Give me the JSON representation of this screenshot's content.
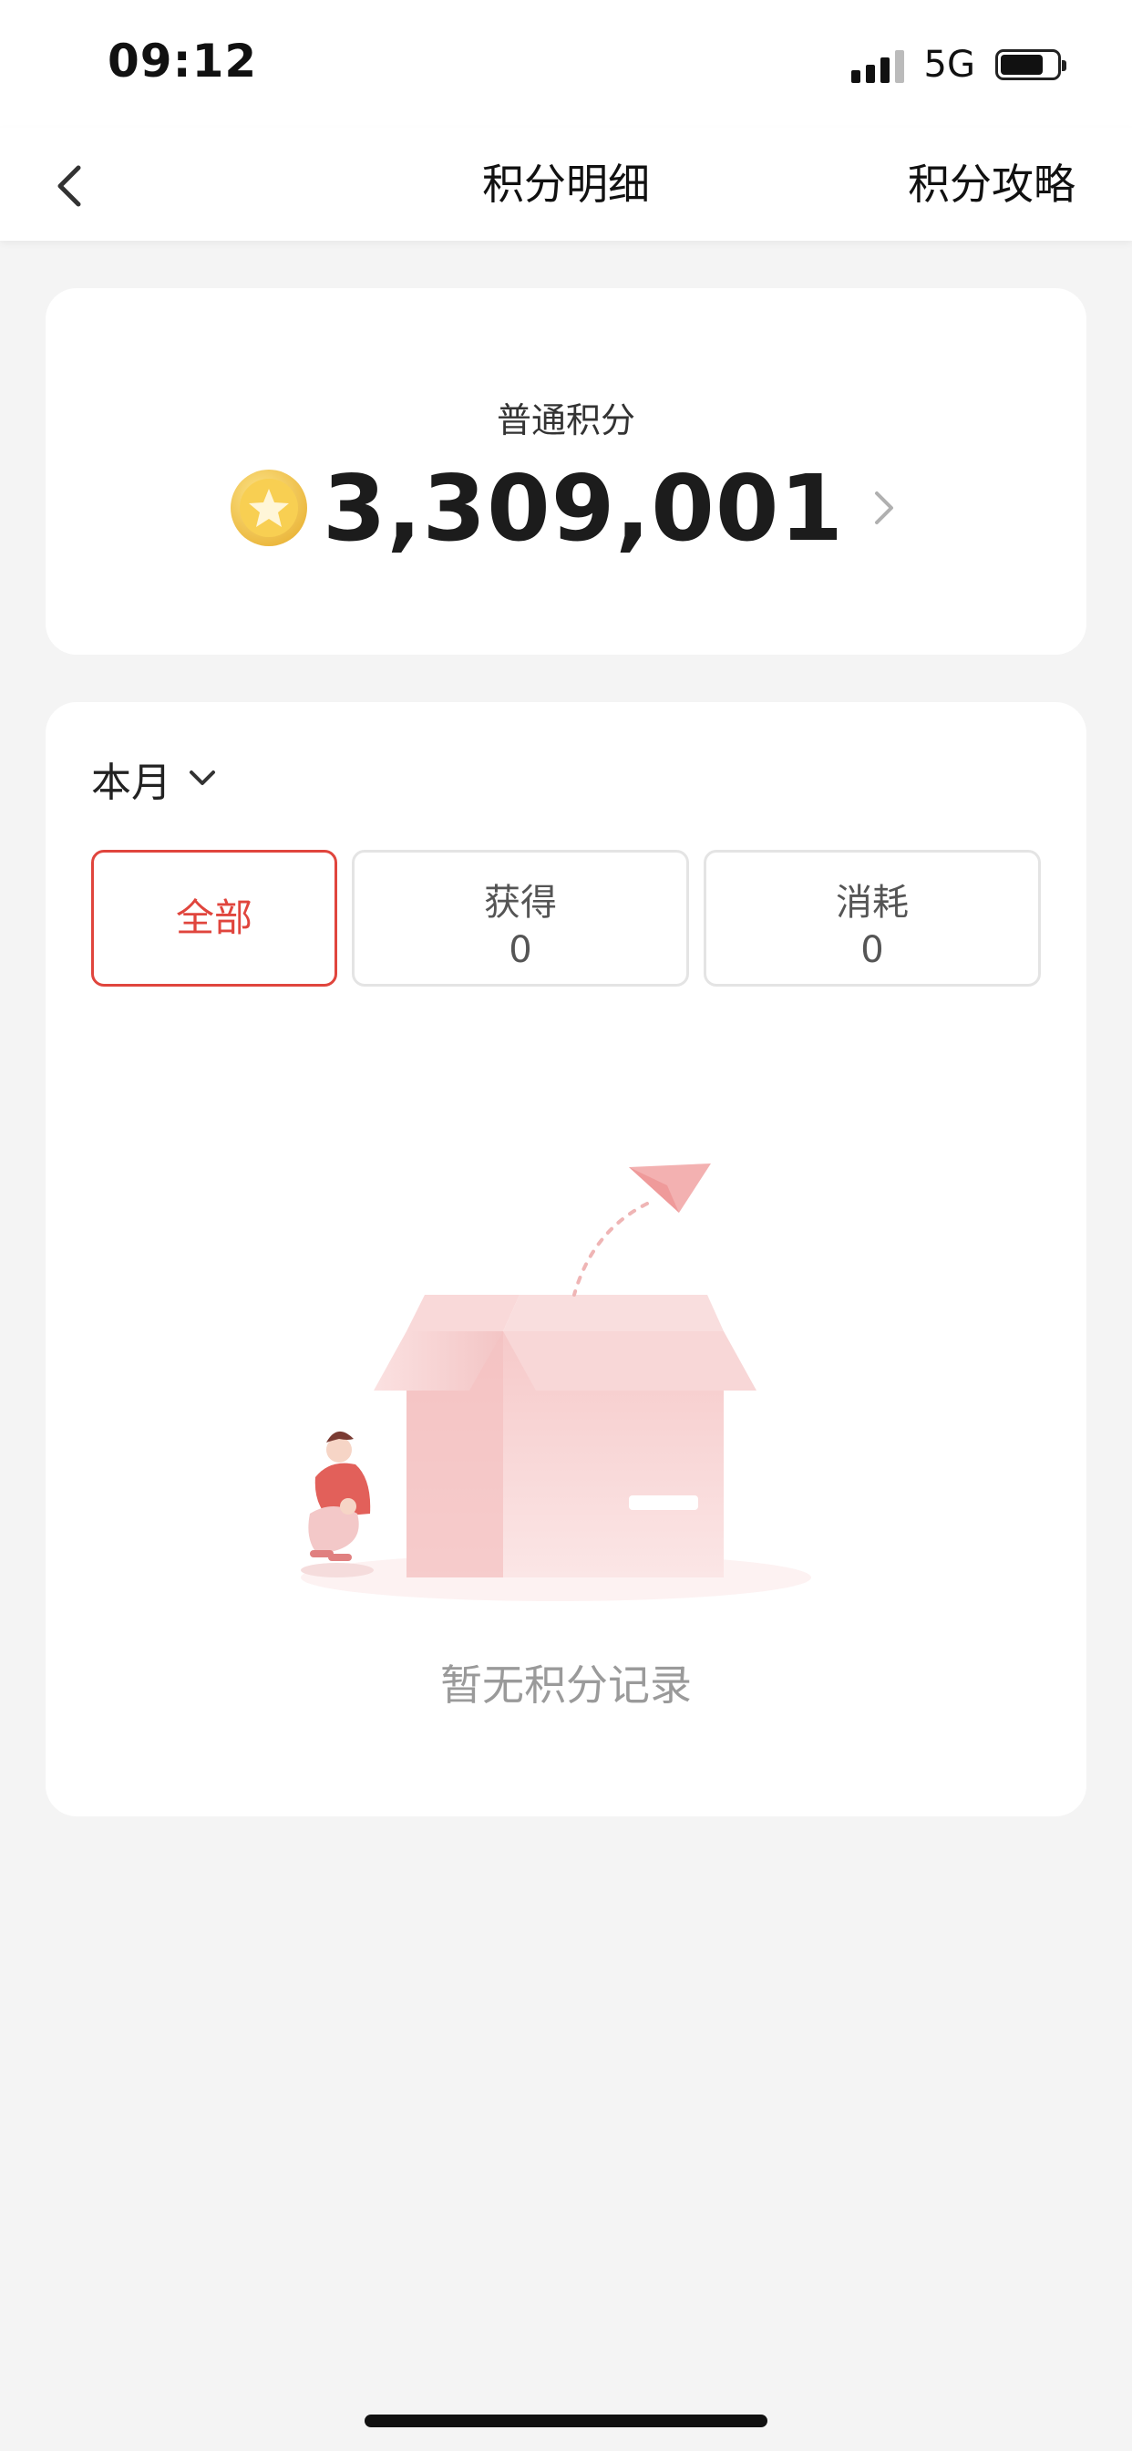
{
  "status_bar": {
    "time": "09:12",
    "network": "5G",
    "icons": [
      "signal-icon",
      "battery-icon"
    ]
  },
  "nav": {
    "back_icon": "chevron-left-icon",
    "title": "积分明细",
    "right_action": "积分攻略"
  },
  "points": {
    "label": "普通积分",
    "value": "3,309,001",
    "coin_icon": "star-coin-icon",
    "arrow_icon": "chevron-right-icon"
  },
  "records": {
    "period": "本月",
    "period_icon": "chevron-down-icon",
    "tabs": [
      {
        "label": "全部",
        "selected": true
      },
      {
        "label": "获得",
        "count": "0",
        "selected": false
      },
      {
        "label": "消耗",
        "count": "0",
        "selected": false
      }
    ],
    "empty_text": "暂无积分记录"
  },
  "colors": {
    "accent": "#e0453d",
    "background": "#f4f4f4",
    "card": "#ffffff",
    "coin": "#f3c94b"
  }
}
